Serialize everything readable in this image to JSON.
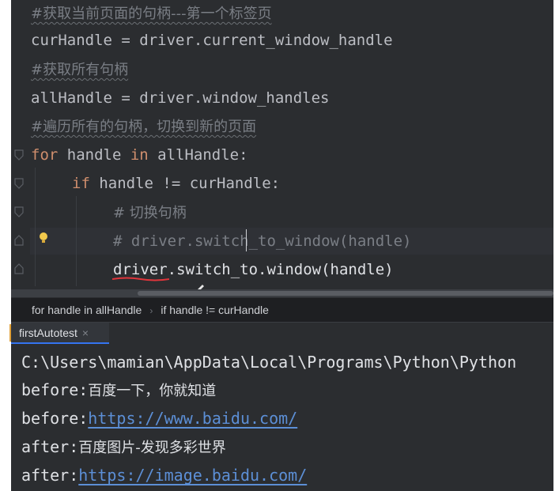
{
  "editor": {
    "lines": [
      {
        "type": "comment",
        "text": "#获取当前页面的句柄---第一个标签页"
      },
      {
        "type": "code",
        "text": "curHandle = driver.current_window_handle"
      },
      {
        "type": "comment",
        "text": "#获取所有句柄"
      },
      {
        "type": "code",
        "text": "allHandle = driver.window_handles"
      },
      {
        "type": "comment",
        "text": "#遍历所有的句柄，切换到新的页面"
      },
      {
        "kw1": "for",
        "mid1": " handle ",
        "kw2": "in",
        "rest": " allHandle:"
      },
      {
        "kw": "if",
        "rest": " handle != curHandle:"
      },
      {
        "text": "# 切换句柄"
      },
      {
        "text": "# driver.switch_to_window(handle)"
      },
      {
        "text": "driver.switch_to.window(handle)"
      }
    ]
  },
  "breadcrumb": {
    "items": [
      "for handle in allHandle",
      "if handle != curHandle"
    ]
  },
  "console_tab": {
    "label": "firstAutotest",
    "close": "×"
  },
  "console": {
    "path_line": "C:\\Users\\mamian\\AppData\\Local\\Programs\\Python\\Python",
    "before1_prefix": "before:",
    "before1_text": "百度一下，你就知道",
    "before2_prefix": "before:",
    "before2_link": "https://www.baidu.com/",
    "after1_prefix": "after:",
    "after1_text": "百度图片-发现多彩世界",
    "after2_prefix": "after:",
    "after2_link": "https://image.baidu.com/"
  },
  "colors": {
    "editor_bg": "#2b2d30",
    "keyword": "#cf8e6d",
    "comment": "#7a7e85",
    "link": "#5c8fd6",
    "tab_underline": "#3574f0"
  }
}
